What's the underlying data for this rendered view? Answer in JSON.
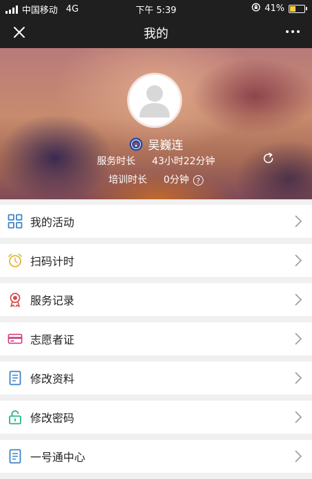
{
  "status_bar": {
    "carrier": "中国移动",
    "network": "4G",
    "time": "下午 5:39",
    "battery": "41%",
    "battery_level": 0.41
  },
  "nav": {
    "title": "我的"
  },
  "profile": {
    "name": "吴巍连",
    "service_label": "服务时长",
    "service_value": "43小时22分钟",
    "training_label": "培训时长",
    "training_value": "0分钟",
    "help_glyph": "?"
  },
  "menu": [
    {
      "label": "我的活动",
      "icon": "grid-icon",
      "color": "#3b83c6"
    },
    {
      "label": "扫码计时",
      "icon": "alarm-clock-icon",
      "color": "#e2b53c"
    },
    {
      "label": "服务记录",
      "icon": "ribbon-badge-icon",
      "color": "#d64b4b"
    },
    {
      "label": "志愿者证",
      "icon": "id-card-icon",
      "color": "#d13d7f"
    },
    {
      "label": "修改资料",
      "icon": "document-icon",
      "color": "#3b83c6"
    },
    {
      "label": "修改密码",
      "icon": "lock-icon",
      "color": "#27b38a"
    },
    {
      "label": "一号通中心",
      "icon": "document-icon",
      "color": "#3b83c6"
    }
  ]
}
